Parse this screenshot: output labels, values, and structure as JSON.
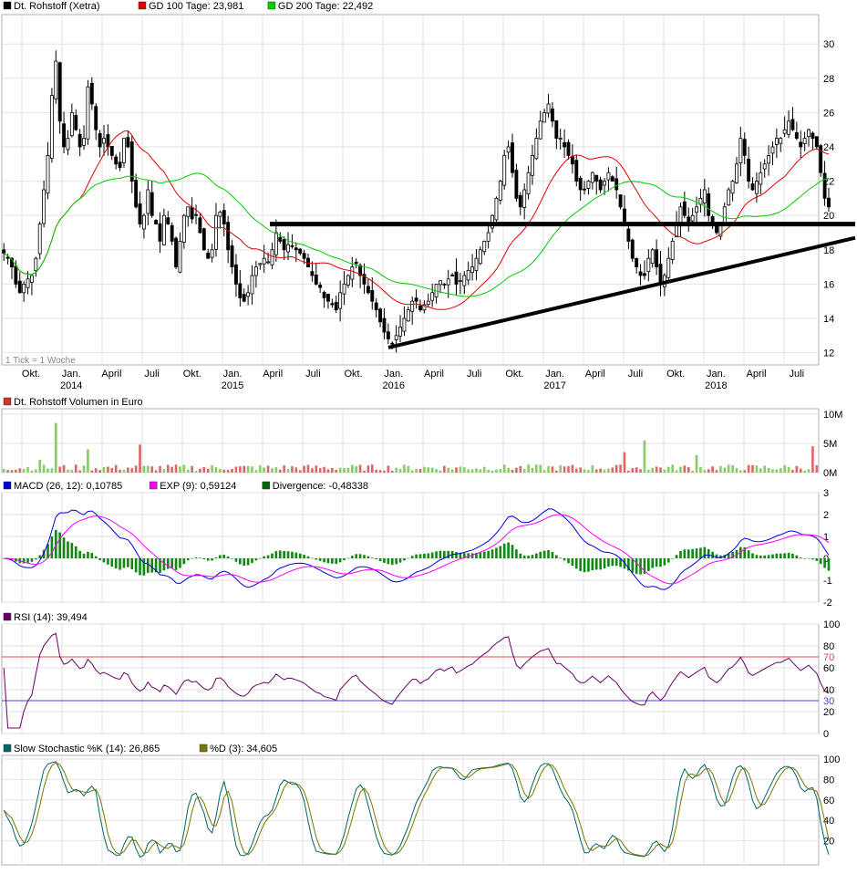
{
  "main_panel": {
    "legend": [
      {
        "label": "Dt. Rohstoff (Xetra)",
        "color": "#000000"
      },
      {
        "label": "GD 100 Tage: 23,981",
        "color": "#e00000"
      },
      {
        "label": "GD 200 Tage: 22,492",
        "color": "#00cc00"
      }
    ],
    "tick_note": "1 Tick = 1 Woche"
  },
  "volume_panel": {
    "legend": [
      {
        "label": "Dt. Rohstoff Volumen in Euro",
        "color": "#cc3333"
      }
    ]
  },
  "macd_panel": {
    "legend": [
      {
        "label": "MACD (26, 12): 0,10785",
        "color": "#0000cc"
      },
      {
        "label": "EXP (9): 0,59124",
        "color": "#ff00ff"
      },
      {
        "label": "Divergence: -0,48338",
        "color": "#006600"
      }
    ]
  },
  "rsi_panel": {
    "legend": [
      {
        "label": "RSI (14): 39,494",
        "color": "#660066"
      }
    ]
  },
  "stoch_panel": {
    "legend": [
      {
        "label": "Slow Stochastic %K (14): 26,865",
        "color": "#006666"
      },
      {
        "label": "%D (3): 34,605",
        "color": "#777700"
      }
    ]
  },
  "chart_data": [
    {
      "type": "candlestick",
      "title": "Dt. Rohstoff (Xetra)",
      "x_tick_labels": [
        {
          "top": "Okt.",
          "bottom": ""
        },
        {
          "top": "Jan.",
          "bottom": "2014"
        },
        {
          "top": "April",
          "bottom": ""
        },
        {
          "top": "Juli",
          "bottom": ""
        },
        {
          "top": "Okt.",
          "bottom": ""
        },
        {
          "top": "Jan.",
          "bottom": "2015"
        },
        {
          "top": "April",
          "bottom": ""
        },
        {
          "top": "Juli",
          "bottom": ""
        },
        {
          "top": "Okt.",
          "bottom": ""
        },
        {
          "top": "Jan.",
          "bottom": "2016"
        },
        {
          "top": "April",
          "bottom": ""
        },
        {
          "top": "Juli",
          "bottom": ""
        },
        {
          "top": "Okt.",
          "bottom": ""
        },
        {
          "top": "Jan.",
          "bottom": "2017"
        },
        {
          "top": "April",
          "bottom": ""
        },
        {
          "top": "Juli",
          "bottom": ""
        },
        {
          "top": "Okt.",
          "bottom": ""
        },
        {
          "top": "Jan.",
          "bottom": "2018"
        },
        {
          "top": "April",
          "bottom": ""
        },
        {
          "top": "Juli",
          "bottom": ""
        }
      ],
      "y_ticks": [
        12,
        14,
        16,
        18,
        20,
        22,
        24,
        26,
        28,
        30
      ],
      "ylim": [
        11.5,
        31.5
      ],
      "close": [
        17.8,
        17.5,
        17.0,
        16.0,
        15.5,
        16.0,
        16.3,
        16.5,
        17.5,
        19.5,
        21.5,
        23.5,
        27.0,
        29.0,
        25.5,
        24.0,
        24.5,
        26.0,
        25.0,
        24.0,
        24.5,
        27.5,
        26.5,
        25.0,
        24.0,
        24.5,
        24.0,
        23.5,
        23.0,
        22.8,
        24.5,
        24.0,
        22.0,
        20.5,
        19.5,
        20.0,
        21.5,
        20.0,
        19.5,
        18.5,
        20.0,
        19.5,
        18.5,
        17.0,
        18.5,
        20.0,
        20.5,
        19.8,
        20.0,
        19.0,
        18.0,
        17.5,
        18.0,
        20.0,
        20.2,
        19.5,
        18.0,
        17.0,
        16.0,
        15.2,
        15.0,
        15.5,
        16.5,
        17.0,
        17.2,
        17.5,
        17.3,
        18.0,
        19.0,
        18.5,
        18.0,
        18.3,
        18.2,
        18.0,
        17.8,
        17.5,
        17.0,
        16.5,
        16.0,
        15.8,
        15.2,
        15.0,
        14.8,
        14.5,
        15.5,
        16.0,
        16.5,
        17.0,
        17.2,
        16.5,
        16.0,
        15.5,
        15.0,
        14.5,
        13.8,
        13.2,
        12.8,
        12.5,
        13.0,
        13.5,
        14.0,
        14.5,
        15.0,
        15.0,
        14.5,
        14.8,
        15.0,
        15.5,
        16.0,
        16.2,
        16.0,
        16.3,
        16.5,
        16.0,
        16.2,
        16.5,
        16.8,
        17.0,
        17.5,
        18.0,
        18.5,
        19.0,
        20.0,
        21.0,
        22.0,
        23.5,
        24.0,
        22.5,
        21.0,
        20.5,
        21.5,
        22.5,
        23.5,
        24.5,
        25.5,
        26.0,
        26.5,
        25.5,
        24.5,
        24.5,
        24.0,
        23.5,
        23.0,
        22.0,
        21.5,
        21.5,
        22.0,
        22.5,
        22.0,
        21.5,
        22.0,
        22.5,
        22.0,
        21.5,
        20.5,
        19.5,
        18.5,
        17.5,
        17.0,
        16.5,
        16.5,
        17.5,
        18.0,
        17.0,
        16.0,
        16.5,
        17.5,
        18.5,
        19.5,
        20.5,
        20.0,
        19.5,
        20.0,
        20.5,
        21.0,
        21.5,
        20.0,
        19.5,
        19.0,
        19.5,
        20.5,
        21.5,
        22.0,
        23.0,
        24.5,
        23.5,
        22.0,
        21.5,
        22.0,
        22.5,
        23.0,
        23.5,
        24.0,
        24.5,
        24.5,
        25.0,
        25.5,
        25.0,
        24.5,
        24.0,
        24.5,
        25.0,
        24.5,
        24.0,
        22.5,
        21.0,
        20.5
      ],
      "gd100_at_end": 23.981,
      "gd200_at_end": 22.492
    },
    {
      "type": "bar",
      "title": "Dt. Rohstoff Volumen in Euro",
      "y_tick_labels": [
        "10M",
        "5M",
        "0M"
      ],
      "ylim": [
        0,
        10
      ],
      "unit": "M",
      "spikes": [
        {
          "bar": 9,
          "value": 2.2
        },
        {
          "bar": 13,
          "value": 8.5
        },
        {
          "bar": 21,
          "value": 4.0
        },
        {
          "bar": 34,
          "value": 4.8
        },
        {
          "bar": 155,
          "value": 3.5
        },
        {
          "bar": 160,
          "value": 5.5
        },
        {
          "bar": 173,
          "value": 3.0
        },
        {
          "bar": 202,
          "value": 4.5
        }
      ]
    },
    {
      "type": "line",
      "title": "MACD",
      "y_ticks": [
        -2,
        -1,
        0,
        1,
        2,
        3
      ],
      "ylim": [
        -2,
        3
      ],
      "series": [
        {
          "name": "MACD (26, 12)",
          "last": 0.10785
        },
        {
          "name": "EXP (9)",
          "last": 0.59124
        },
        {
          "name": "Divergence",
          "last": -0.48338
        }
      ]
    },
    {
      "type": "line",
      "title": "RSI (14)",
      "y_ticks": [
        0,
        20,
        40,
        60,
        80,
        100
      ],
      "ylim": [
        0,
        100
      ],
      "reference_levels": [
        {
          "label": "70",
          "value": 70,
          "color": "#dd4444"
        },
        {
          "label": "30",
          "value": 30,
          "color": "#4444dd"
        }
      ],
      "last": 39.494
    },
    {
      "type": "line",
      "title": "Slow Stochastic",
      "y_ticks": [
        20,
        40,
        60,
        80,
        100
      ],
      "ylim": [
        0,
        100
      ],
      "series": [
        {
          "name": "%K (14)",
          "last": 26.865
        },
        {
          "name": "%D (3)",
          "last": 34.605
        }
      ]
    }
  ]
}
